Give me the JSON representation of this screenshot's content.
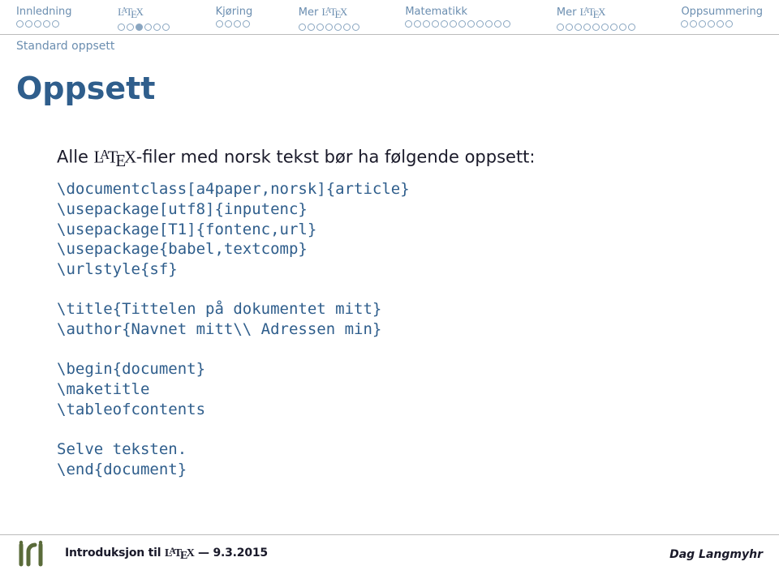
{
  "nav": {
    "items": [
      {
        "label": "Innledning",
        "dots": 5,
        "current": -1
      },
      {
        "label": "LATEX",
        "dots": 6,
        "current": 2,
        "is_latex": true
      },
      {
        "label": "Kjøring",
        "dots": 4,
        "current": -1
      },
      {
        "label": "Mer LATEX",
        "dots": 7,
        "current": -1,
        "is_latex": true,
        "prefix": "Mer "
      },
      {
        "label": "Matematikk",
        "dots": 12,
        "current": -1
      },
      {
        "label": "Mer LATEX",
        "dots": 9,
        "current": -1,
        "is_latex": true,
        "prefix": "Mer "
      },
      {
        "label": "Oppsummering",
        "dots": 6,
        "current": -1
      }
    ]
  },
  "subhead": "Standard oppsett",
  "title": "Oppsett",
  "intro_prefix": "Alle ",
  "intro_suffix": "-filer med norsk tekst bør ha følgende oppsett:",
  "code": "\\documentclass[a4paper,norsk]{article}\n\\usepackage[utf8]{inputenc}\n\\usepackage[T1]{fontenc,url}\n\\usepackage{babel,textcomp}\n\\urlstyle{sf}\n\n\\title{Tittelen på dokumentet mitt}\n\\author{Navnet mitt\\\\ Adressen min}\n\n\\begin{document}\n\\maketitle\n\\tableofcontents\n\nSelve teksten.\n\\end{document}",
  "footer": {
    "title_prefix": "Introduksjon til ",
    "date": "— 9.3.2015",
    "author": "Dag Langmyhr"
  }
}
